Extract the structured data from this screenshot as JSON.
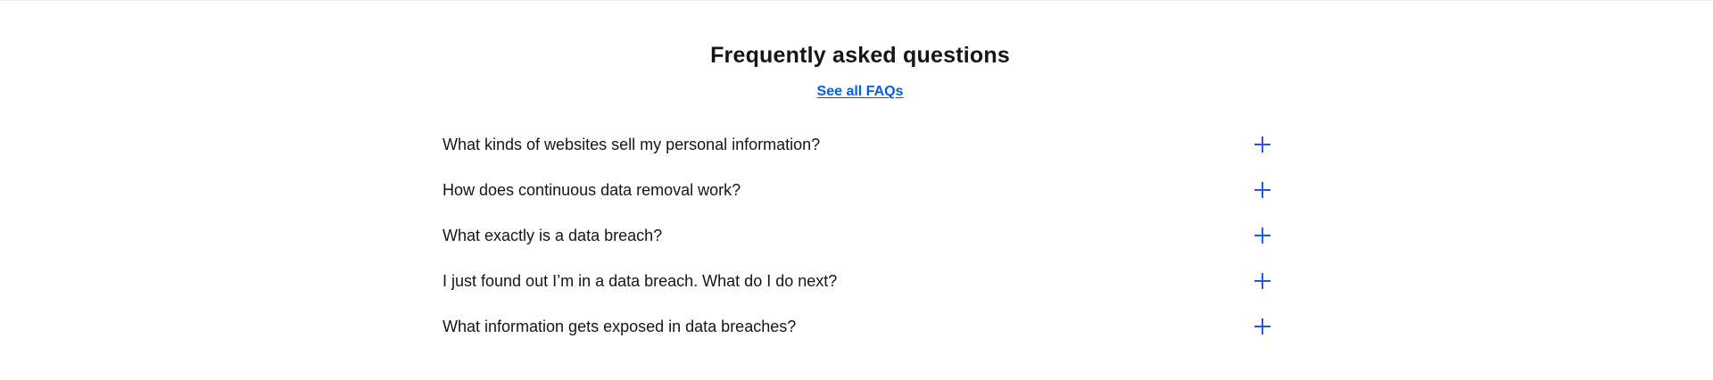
{
  "faq": {
    "title": "Frequently asked questions",
    "see_all_link": "See all FAQs",
    "items": [
      {
        "question": "What kinds of websites sell my personal information?",
        "icon": "plus-icon"
      },
      {
        "question": "How does continuous data removal work?",
        "icon": "plus-icon"
      },
      {
        "question": "What exactly is a data breach?",
        "icon": "plus-icon"
      },
      {
        "question": "I just found out I’m in a data breach. What do I do next?",
        "icon": "plus-icon"
      },
      {
        "question": "What information gets exposed in data breaches?",
        "icon": "plus-icon"
      }
    ]
  },
  "colors": {
    "text": "#15141a",
    "link": "#0060df",
    "icon": "#1d5bd8",
    "divider": "#ededf0"
  }
}
